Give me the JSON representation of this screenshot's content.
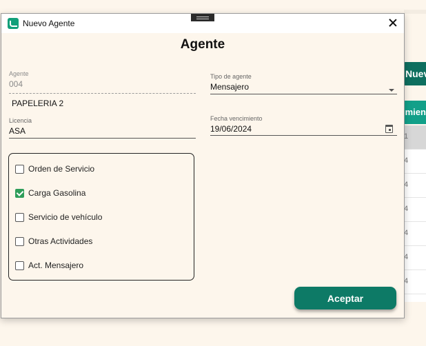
{
  "background": {
    "nuevo_button_label": "Nuev",
    "tab_label": "imien",
    "row_marks": [
      "1",
      "4",
      "4",
      "4",
      "4",
      "4",
      "4"
    ]
  },
  "window": {
    "title": "Nuevo Agente",
    "heading": "Agente"
  },
  "form": {
    "agente": {
      "label": "Agente",
      "value": "004"
    },
    "agente_name": "PAPELERIA 2",
    "licencia": {
      "label": "Licencia",
      "value": "ASA"
    },
    "tipo_agente": {
      "label": "Tipo de agente",
      "value": "Mensajero"
    },
    "fecha_vencimiento": {
      "label": "Fecha vencimiento",
      "value": "19/06/2024"
    }
  },
  "activities": [
    {
      "label": "Orden de Servicio",
      "checked": false
    },
    {
      "label": "Carga Gasolina",
      "checked": true
    },
    {
      "label": "Servicio de vehículo",
      "checked": false
    },
    {
      "label": "Otras Actividades",
      "checked": false
    },
    {
      "label": "Act. Mensajero",
      "checked": false
    }
  ],
  "actions": {
    "accept_label": "Aceptar"
  },
  "colors": {
    "accent": "#0d7a66",
    "check": "#2e9d5a",
    "background": "#fdf6ec"
  }
}
